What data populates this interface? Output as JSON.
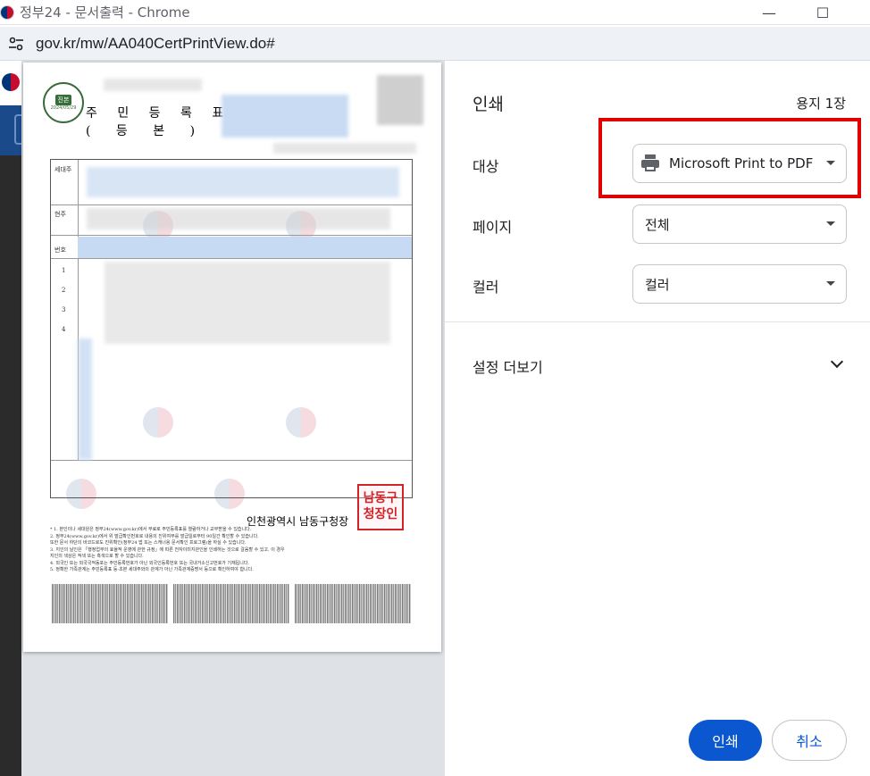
{
  "window": {
    "title": "정부24 - 문서출력 - Chrome",
    "minimize_glyph": "—",
    "maximize_glyph": "☐"
  },
  "address_bar": {
    "url": "gov.kr/mw/AA040CertPrintView.do#"
  },
  "document": {
    "seal_label": "진본",
    "seal_date": "2024/05/29",
    "title": "주 민 등 록 표",
    "subtitle": "( 등   본 )",
    "row_labels": [
      "세대주",
      "현주",
      "번호"
    ],
    "row_numbers": [
      "1",
      "2",
      "3",
      "4"
    ],
    "issuer": "인천광역시 남동구청장",
    "stamp_text": "남동구청장인",
    "notes": [
      "* 1. 본인이나 세대원은 정부24(www.gov.kr)에서 무료로 주민등록표를 열람하거나 교부받을 수 있습니다.",
      "  2. 정부24(www.gov.kr)에서 위 발급확인번호로 내용의 진위여부를 발급일로부터 90일간 확인할 수 있습니다.",
      "     또한 문서 하단의 바코드로도 진위확인(정부24 앱 또는 스캐너용 문서확인 프로그램)을 하실 수 있습니다.",
      "  3. 지인의 날인은 「행정업무의 효율적 운영에 관한 규정」에 따른 전자이미지관인을 인쇄하는 것으로 갈음할 수 있고, 이 경우",
      "     지인의 색상은 적색 또는 흑색으로 할 수 있습니다.",
      "  4. 외국인 또는 외국국적동포는 주민등록번호가 아닌 외국인등록번호 또는 국내거소신고번호가 기재됩니다.",
      "  5. 정확한 가족관계는 주민등록표 등·초본 세대주와의 관계가 아닌 가족관계증명서 등으로 확인하여야 합니다."
    ]
  },
  "print_panel": {
    "title": "인쇄",
    "sheet_count": "용지 1장",
    "destination_label": "대상",
    "destination_value": "Microsoft Print to PDF",
    "pages_label": "페이지",
    "pages_value": "전체",
    "color_label": "컬러",
    "color_value": "컬러",
    "more_settings": "설정 더보기",
    "print_button": "인쇄",
    "cancel_button": "취소"
  },
  "colors": {
    "highlight_box": "#e00000",
    "primary_button": "#0b57d0",
    "stamp": "#d2232a"
  },
  "icons": {
    "tune": "tune-icon",
    "printer": "printer-icon",
    "chevron": "chevron-down-icon"
  }
}
